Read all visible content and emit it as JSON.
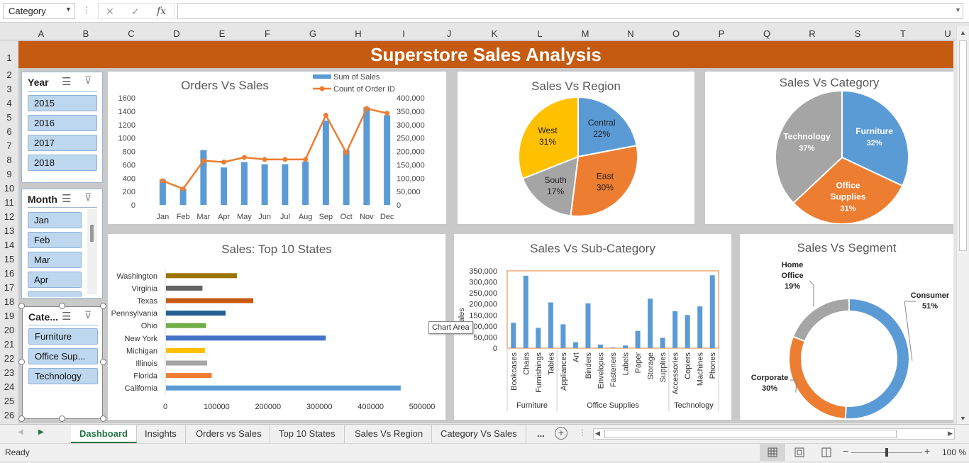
{
  "formula": {
    "name_box": "Category",
    "cancel_icon": "✕",
    "enter_icon": "✓",
    "fx_label": "fx",
    "value": ""
  },
  "columns": [
    "A",
    "B",
    "C",
    "D",
    "E",
    "F",
    "G",
    "H",
    "I",
    "J",
    "K",
    "L",
    "M",
    "N",
    "O",
    "P",
    "Q",
    "R",
    "S",
    "T",
    "U"
  ],
  "rows": [
    "1",
    "2",
    "3",
    "4",
    "5",
    "6",
    "7",
    "8",
    "9",
    "10",
    "11",
    "12",
    "13",
    "14",
    "15",
    "16",
    "17",
    "18",
    "19",
    "20",
    "21",
    "22",
    "23",
    "24",
    "25",
    "26"
  ],
  "dashboard_title": "Superstore Sales Analysis",
  "slicers": {
    "year": {
      "title": "Year",
      "items": [
        "2015",
        "2016",
        "2017",
        "2018"
      ]
    },
    "month": {
      "title": "Month",
      "items": [
        "Jan",
        "Feb",
        "Mar",
        "Apr"
      ]
    },
    "category": {
      "title": "Cate...",
      "items": [
        "Furniture",
        "Office Sup...",
        "Technology"
      ]
    }
  },
  "tooltip": "Chart Area",
  "sheet_tabs": [
    "Dashboard",
    "Insights",
    "Orders vs Sales",
    "Top 10 States",
    "Sales Vs Region",
    "Category Vs Sales",
    "..."
  ],
  "status": {
    "ready": "Ready",
    "zoom": "100 %"
  },
  "chart_data": [
    {
      "id": "orders_vs_sales",
      "type": "bar",
      "title": "Orders Vs Sales",
      "categories": [
        "Jan",
        "Feb",
        "Mar",
        "Apr",
        "May",
        "Jun",
        "Jul",
        "Aug",
        "Sep",
        "Oct",
        "Nov",
        "Dec"
      ],
      "series": [
        {
          "name": "Sum of Sales",
          "type": "bar",
          "axis": "right",
          "color": "#5b9bd5",
          "values": [
            95000,
            60000,
            205000,
            140000,
            160000,
            152000,
            152000,
            162000,
            315000,
            205000,
            365000,
            335000
          ]
        },
        {
          "name": "Count of Order ID",
          "type": "line",
          "axis": "left",
          "color": "#ed7d31",
          "values": [
            360,
            240,
            660,
            640,
            710,
            680,
            680,
            680,
            1340,
            780,
            1440,
            1370
          ]
        }
      ],
      "y_left": {
        "ticks": [
          "1600",
          "1400",
          "1200",
          "1000",
          "800",
          "600",
          "400",
          "200",
          "0"
        ],
        "range": [
          0,
          1600
        ]
      },
      "y_right": {
        "ticks": [
          "400,000",
          "350,000",
          "300,000",
          "250,000",
          "200,000",
          "150,000",
          "100,000",
          "50,000",
          "0"
        ],
        "range": [
          0,
          400000
        ]
      },
      "legend": "top"
    },
    {
      "id": "sales_vs_region",
      "type": "pie",
      "title": "Sales Vs Region",
      "slices": [
        {
          "label": "Central",
          "value": 22,
          "pct": "22%",
          "color": "#5b9bd5"
        },
        {
          "label": "East",
          "value": 30,
          "pct": "30%",
          "color": "#ed7d31"
        },
        {
          "label": "South",
          "value": 17,
          "pct": "17%",
          "color": "#a5a5a5"
        },
        {
          "label": "West",
          "value": 31,
          "pct": "31%",
          "color": "#ffc000"
        }
      ]
    },
    {
      "id": "sales_vs_category",
      "type": "pie",
      "title": "Sales Vs Category",
      "slices": [
        {
          "label": "Furniture",
          "value": 32,
          "pct": "32%",
          "color": "#5b9bd5"
        },
        {
          "label": "Office Supplies",
          "value": 31,
          "pct": "31%",
          "color": "#ed7d31"
        },
        {
          "label": "Technology",
          "value": 37,
          "pct": "37%",
          "color": "#a5a5a5"
        }
      ]
    },
    {
      "id": "top10_states",
      "type": "bar",
      "orientation": "horizontal",
      "title": "Sales: Top 10 States",
      "categories": [
        "Washington",
        "Virginia",
        "Texas",
        "Pennsylvania",
        "Ohio",
        "New York",
        "Michigan",
        "Illinois",
        "Florida",
        "California"
      ],
      "values": [
        138000,
        71000,
        170000,
        116000,
        78000,
        311000,
        76000,
        80000,
        89000,
        457000
      ],
      "colors": [
        "#997300",
        "#636363",
        "#c55a11",
        "#255e91",
        "#70ad47",
        "#4472c4",
        "#ffc000",
        "#a5a5a5",
        "#ed7d31",
        "#5b9bd5"
      ],
      "x_ticks": [
        "0",
        "100000",
        "200000",
        "300000",
        "400000",
        "500000"
      ],
      "xlim": [
        0,
        500000
      ]
    },
    {
      "id": "sales_vs_subcategory",
      "type": "bar",
      "title": "Sales Vs Sub-Category",
      "ylabel": "Sales",
      "categories": [
        "Bookcases",
        "Chairs",
        "Furnishings",
        "Tables",
        "Appliances",
        "Art",
        "Binders",
        "Envelopes",
        "Fasteners",
        "Labels",
        "Paper",
        "Storage",
        "Supplies",
        "Accessories",
        "Copiers",
        "Machines",
        "Phones"
      ],
      "values": [
        115000,
        328000,
        92000,
        207000,
        108000,
        27000,
        203000,
        16000,
        3000,
        12000,
        78000,
        224000,
        47000,
        167000,
        150000,
        189000,
        330000
      ],
      "groups": [
        {
          "label": "Furniture",
          "count": 4
        },
        {
          "label": "Office Supplies",
          "count": 9
        },
        {
          "label": "Technology",
          "count": 4
        }
      ],
      "y_ticks": [
        "350,000",
        "300,000",
        "250,000",
        "200,000",
        "150,000",
        "100,000",
        "50,000",
        "0"
      ],
      "ylim": [
        0,
        350000
      ],
      "color": "#5b9bd5"
    },
    {
      "id": "sales_vs_segment",
      "type": "pie",
      "subtype": "donut",
      "title": "Sales Vs Segment",
      "slices": [
        {
          "label": "Consumer",
          "value": 51,
          "pct": "51%",
          "color": "#5b9bd5"
        },
        {
          "label": "Corporate",
          "value": 30,
          "pct": "30%",
          "color": "#ed7d31"
        },
        {
          "label": "Home Office",
          "value": 19,
          "pct": "19%",
          "color": "#a5a5a5"
        }
      ]
    }
  ]
}
